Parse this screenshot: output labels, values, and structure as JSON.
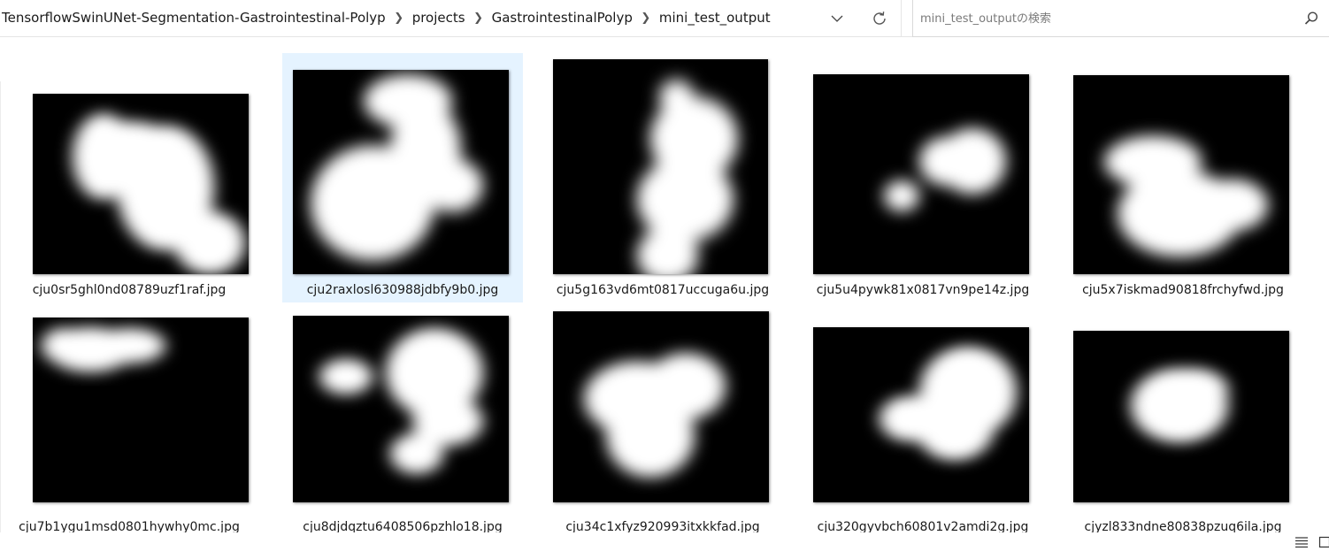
{
  "breadcrumb": [
    "TensorflowSwinUNet-Segmentation-Gastrointestinal-Polyp",
    "projects",
    "GastrointestinalPolyp",
    "mini_test_output"
  ],
  "search": {
    "placeholder": "mini_test_outputの検索"
  },
  "icons": {
    "dropdown": "chevron-down-icon",
    "refresh": "refresh-icon",
    "search": "search-icon",
    "separator": "chevron-right-icon",
    "details_view": "details-view-icon",
    "large_icons_view": "large-icons-view-icon"
  },
  "colors": {
    "selection": "#e5f3ff",
    "mask_background": "#000000",
    "mask_foreground": "#ffffff"
  },
  "files": [
    {
      "name": "cju0sr5ghl0nd08789uzf1raf.jpg",
      "selected": false
    },
    {
      "name": "cju2raxlosl630988jdbfy9b0.jpg",
      "selected": true
    },
    {
      "name": "cju5g163vd6mt0817uccuga6u.jpg",
      "selected": false
    },
    {
      "name": "cju5u4pywk81x0817vn9pe14z.jpg",
      "selected": false
    },
    {
      "name": "cju5x7iskmad90818frchyfwd.jpg",
      "selected": false
    },
    {
      "name": "cju7b1ygu1msd0801hywhy0mc.jpg",
      "selected": false
    },
    {
      "name": "cju8djdqztu6408506pzhlo18.jpg",
      "selected": false
    },
    {
      "name": "cju34c1xfyz920993itxkkfad.jpg",
      "selected": false
    },
    {
      "name": "cju320gyvbch60801v2amdi2g.jpg",
      "selected": false
    },
    {
      "name": "cjyzl833ndne80838pzuq6ila.jpg",
      "selected": false
    }
  ]
}
